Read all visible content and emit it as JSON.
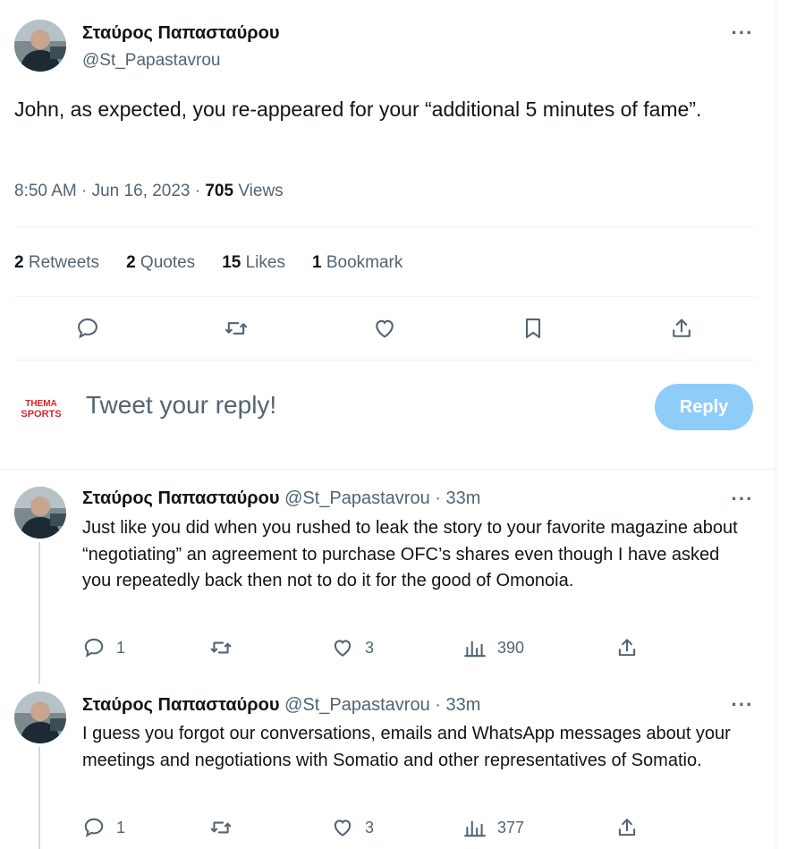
{
  "main_tweet": {
    "author_name": "Σταύρος Παπασταύρου",
    "author_handle": "@St_Papastavrou",
    "text": "John, as expected, you re-appeared for your “additional 5 minutes of fame”.",
    "time": "8:50 AM · Jun 16, 2023 · ",
    "views_count": "705",
    "views_label": " Views",
    "stats": {
      "retweets_count": "2",
      "retweets_label": " Retweets",
      "quotes_count": "2",
      "quotes_label": " Quotes",
      "likes_count": "15",
      "likes_label": " Likes",
      "bookmarks_count": "1",
      "bookmarks_label": " Bookmark"
    },
    "actions": [
      "reply-icon",
      "retweet-icon",
      "like-icon",
      "bookmark-icon",
      "share-icon"
    ]
  },
  "composer": {
    "logo_line1": "THEMA",
    "logo_line2": "SPORTS",
    "placeholder": "Tweet your reply!",
    "reply_button": "Reply"
  },
  "replies": [
    {
      "author_name": "Σταύρος Παπασταύρου",
      "meta": " @St_Papastavrou · 33m",
      "text": "Just like you did when you rushed to leak the story to your favorite magazine about “negotiating” an agreement to purchase OFC’s shares even though I have asked you repeatedly back then not to do it for the good of Omonoia.",
      "replies": "1",
      "retweets": "",
      "likes": "3",
      "views": "390"
    },
    {
      "author_name": "Σταύρος Παπασταύρου",
      "meta": " @St_Papastavrou · 33m",
      "text": "I guess you forgot our conversations, emails and WhatsApp messages about your meetings and negotiations with Somatio and other representatives of Somatio.",
      "replies": "1",
      "retweets": "",
      "likes": "3",
      "views": "377"
    }
  ],
  "colors": {
    "text_primary": "#0f1419",
    "text_secondary": "#536471",
    "reply_button_bg": "#8ecdf8",
    "logo_red": "#d8262b",
    "divider": "#eff3f4"
  }
}
